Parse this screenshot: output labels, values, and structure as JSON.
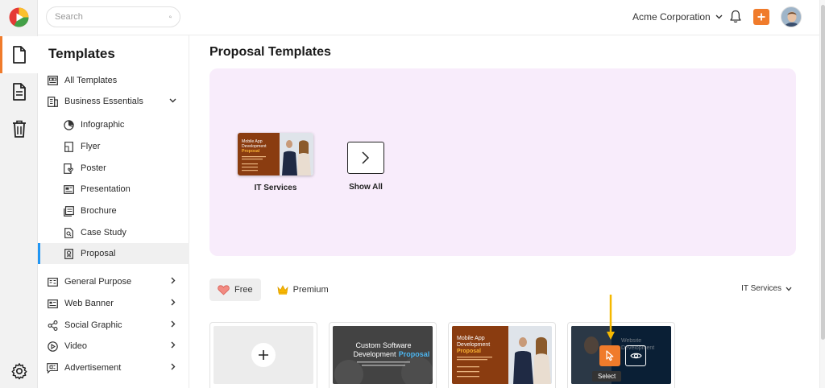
{
  "search": {
    "placeholder": "Search"
  },
  "header": {
    "org_name": "Acme Corporation"
  },
  "colors": {
    "accent": "#f07b2b",
    "active_nav": "#2196f3",
    "hero_bg": "#f8ecfb"
  },
  "sidebar": {
    "title": "Templates",
    "items": [
      {
        "label": "All Templates",
        "icon": "grid-icon"
      },
      {
        "label": "Business Essentials",
        "icon": "building-icon",
        "expanded": true
      },
      {
        "label": "Infographic",
        "icon": "pie-chart-icon"
      },
      {
        "label": "Flyer",
        "icon": "flyer-icon"
      },
      {
        "label": "Poster",
        "icon": "poster-icon"
      },
      {
        "label": "Presentation",
        "icon": "presentation-icon"
      },
      {
        "label": "Brochure",
        "icon": "brochure-icon"
      },
      {
        "label": "Case Study",
        "icon": "case-study-icon"
      },
      {
        "label": "Proposal",
        "icon": "proposal-icon",
        "active": true
      },
      {
        "label": "General Purpose",
        "icon": "general-icon"
      },
      {
        "label": "Web Banner",
        "icon": "banner-icon"
      },
      {
        "label": "Social Graphic",
        "icon": "social-icon"
      },
      {
        "label": "Video",
        "icon": "video-icon"
      },
      {
        "label": "Advertisement",
        "icon": "megaphone-icon"
      }
    ]
  },
  "main": {
    "title": "Proposal Templates",
    "categories": [
      {
        "label": "IT Services",
        "thumb_lines": [
          "Mobile App",
          "Development",
          "Proposal"
        ]
      },
      {
        "label": "Show All"
      }
    ],
    "filters": {
      "free": "Free",
      "premium": "Premium",
      "sort": "IT Services"
    },
    "cards": [
      {
        "type": "blank"
      },
      {
        "type": "template",
        "lines": [
          "Custom Software",
          "Development",
          "Proposal"
        ]
      },
      {
        "type": "template",
        "lines": [
          "Mobile App",
          "Development",
          "Proposal"
        ]
      },
      {
        "type": "template",
        "lines": [
          "Website",
          "Development"
        ]
      }
    ],
    "hover": {
      "tooltip": "Select"
    }
  }
}
